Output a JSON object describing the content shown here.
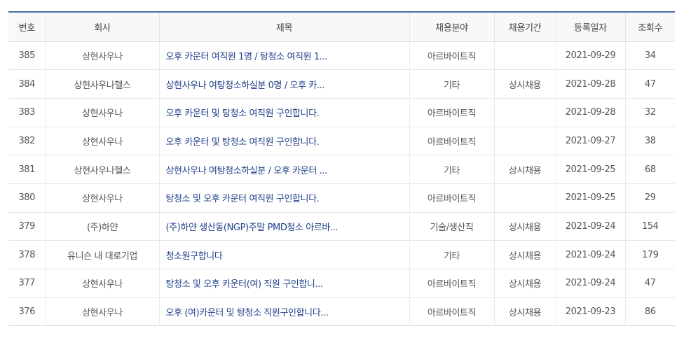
{
  "columns": [
    "번호",
    "회사",
    "제목",
    "채용분야",
    "채용기간",
    "등록일자",
    "조회수"
  ],
  "rows": [
    {
      "no": "385",
      "company": "상현사우나",
      "title": "오후 카운터 여직원 1명 / 탕청소 여직원 1...",
      "field": "아르바이트직",
      "period": "",
      "date": "2021-09-29",
      "views": "34"
    },
    {
      "no": "384",
      "company": "상현사우나헬스",
      "title": "상현사우나 여탕청소하실분 0명 / 오후 카...",
      "field": "기타",
      "period": "상시채용",
      "date": "2021-09-28",
      "views": "47"
    },
    {
      "no": "383",
      "company": "상현사우나",
      "title": "오후 카운터 및 탕청소 여직원 구인합니다.",
      "field": "아르바이트직",
      "period": "",
      "date": "2021-09-28",
      "views": "32"
    },
    {
      "no": "382",
      "company": "상현사우나",
      "title": "오후 카운터 및 탕청소 여직원 구인합니다.",
      "field": "아르바이트직",
      "period": "",
      "date": "2021-09-27",
      "views": "38"
    },
    {
      "no": "381",
      "company": "상현사우나헬스",
      "title": "상현사우나 여탕청소하실분 / 오후 카운터 ...",
      "field": "기타",
      "period": "상시채용",
      "date": "2021-09-25",
      "views": "68"
    },
    {
      "no": "380",
      "company": "상현사우나",
      "title": "탕청소 및 오후 카운터 여직원 구인합니다.",
      "field": "아르바이트직",
      "period": "",
      "date": "2021-09-25",
      "views": "29"
    },
    {
      "no": "379",
      "company": "(주)하얀",
      "title": "(주)하얀 생산동(NGP)주말 PMD청소 아르바...",
      "field": "기술/생산직",
      "period": "상시채용",
      "date": "2021-09-24",
      "views": "154"
    },
    {
      "no": "378",
      "company": "유니슨 내 대로기업",
      "title": "청소원구합니다",
      "field": "기타",
      "period": "상시채용",
      "date": "2021-09-24",
      "views": "179"
    },
    {
      "no": "377",
      "company": "상현사우나",
      "title": "탕청소 및 오후 카운터(여) 직원 구인합니...",
      "field": "아르바이트직",
      "period": "상시채용",
      "date": "2021-09-24",
      "views": "47"
    },
    {
      "no": "376",
      "company": "상현사우나",
      "title": "오후 (여)카운터 및 탕청소 직원구인합니다...",
      "field": "아르바이트직",
      "period": "상시채용",
      "date": "2021-09-23",
      "views": "86"
    }
  ]
}
